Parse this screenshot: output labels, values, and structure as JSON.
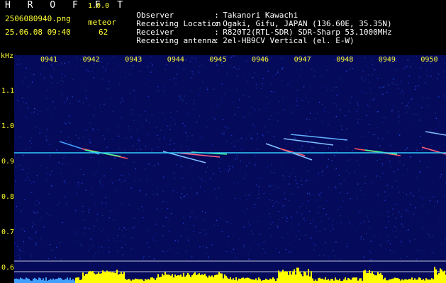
{
  "header": {
    "app_title": "H R O F F T",
    "app_version": "1.0.0",
    "file_name": "2506080940.png",
    "date_time": "25.06.08 09:40",
    "meteor_label": "meteor",
    "meteor_count": "62"
  },
  "info": [
    {
      "key": "Observer",
      "value": "Takanori Kawachi"
    },
    {
      "key": "Receiving Location",
      "value": "Ogaki, Gifu, JAPAN (136.60E, 35.35N)"
    },
    {
      "key": "Receiver",
      "value": "R820T2(RTL-SDR) SDR-Sharp 53.1000MHz"
    },
    {
      "key": "Receiving antenna",
      "value": "2el-HB9CV Vertical (el. E-W)"
    }
  ],
  "axis": {
    "y_unit": "kHz",
    "y_ticks": [
      "1.1",
      "1.0",
      "0.9",
      "0.8",
      "0.7",
      "0.6"
    ],
    "x_ticks": [
      "0941",
      "0942",
      "0943",
      "0944",
      "0945",
      "0946",
      "0947",
      "0948",
      "0949",
      "0950"
    ]
  },
  "colors": {
    "background": "#000000",
    "plot_background": "#050a5a",
    "label_yellow": "#ffff33",
    "carrier": "#33ccff",
    "activity": "#ffff00"
  }
}
